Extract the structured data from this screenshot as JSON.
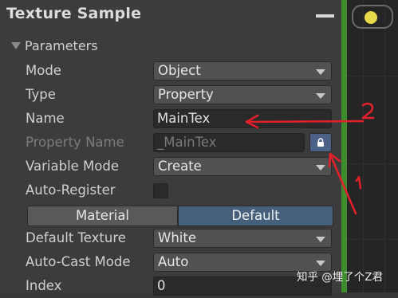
{
  "window": {
    "title": "Texture Sample"
  },
  "section": {
    "label": "Parameters"
  },
  "fields": {
    "mode": {
      "label": "Mode",
      "value": "Object"
    },
    "type": {
      "label": "Type",
      "value": "Property"
    },
    "name": {
      "label": "Name",
      "value": "MainTex"
    },
    "property_name": {
      "label": "Property Name",
      "value": "_MainTex"
    },
    "variable_mode": {
      "label": "Variable Mode",
      "value": "Create"
    },
    "auto_register": {
      "label": "Auto-Register",
      "checked": false
    },
    "default_texture": {
      "label": "Default Texture",
      "value": "White"
    },
    "auto_cast_mode": {
      "label": "Auto-Cast Mode",
      "value": "Auto"
    },
    "index": {
      "label": "Index",
      "value": "0"
    }
  },
  "toggle": {
    "left": "Material",
    "right": "Default",
    "selected": "Default"
  },
  "annotations": {
    "arrow1": "1",
    "arrow2": "2",
    "color": "#e0202a"
  },
  "watermark": {
    "text": "知乎 @埋了个Z君"
  },
  "colors": {
    "accent_green": "#3f8c2e",
    "selected_blue": "#46607c"
  }
}
